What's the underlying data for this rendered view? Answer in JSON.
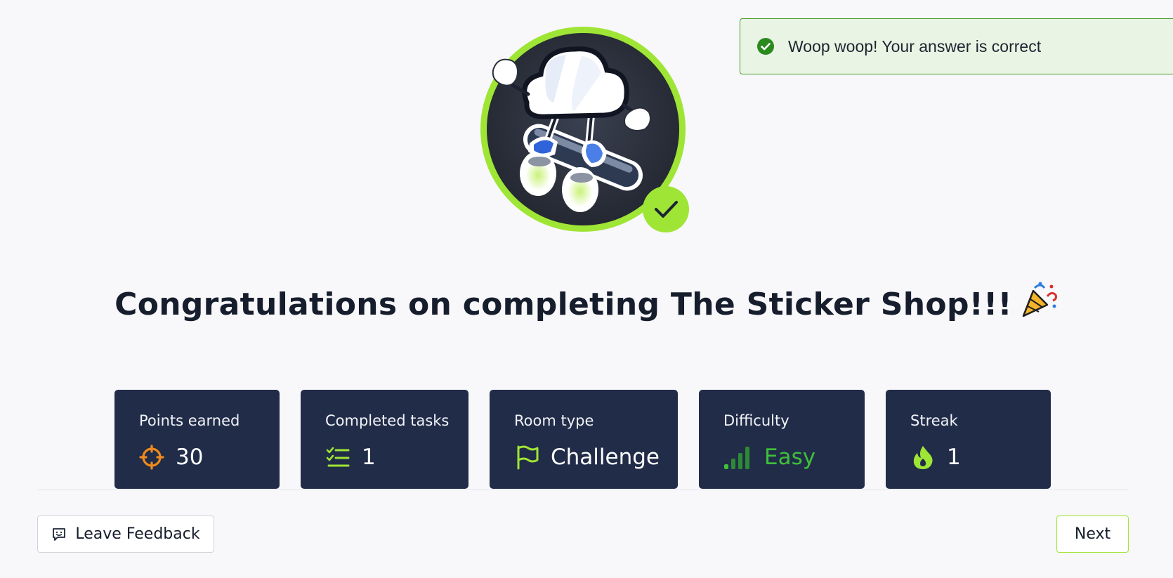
{
  "toast": {
    "message": "Woop woop! Your answer is correct",
    "icon": "check-circle-icon",
    "status_color": "#2b8a1e"
  },
  "badge": {
    "icon": "room-badge-sticker-icon",
    "completed_icon": "check-icon",
    "accent_color": "#9fe535"
  },
  "heading": {
    "text": "Congratulations on completing The Sticker Shop!!!",
    "icon": "party-popper-icon"
  },
  "stats": [
    {
      "label": "Points earned",
      "value": "30",
      "icon": "target-icon"
    },
    {
      "label": "Completed tasks",
      "value": "1",
      "icon": "checklist-icon"
    },
    {
      "label": "Room type",
      "value": "Challenge",
      "icon": "flag-icon"
    },
    {
      "label": "Difficulty",
      "value": "Easy",
      "icon": "signal-bars-icon",
      "value_color": "#3fbf3a"
    },
    {
      "label": "Streak",
      "value": "1",
      "icon": "flame-icon"
    }
  ],
  "actions": {
    "feedback_label": "Leave Feedback",
    "feedback_icon": "feedback-icon",
    "next_label": "Next"
  },
  "colors": {
    "card_bg": "#212c48",
    "accent": "#9fe535",
    "page_bg": "#f8f8fa"
  }
}
